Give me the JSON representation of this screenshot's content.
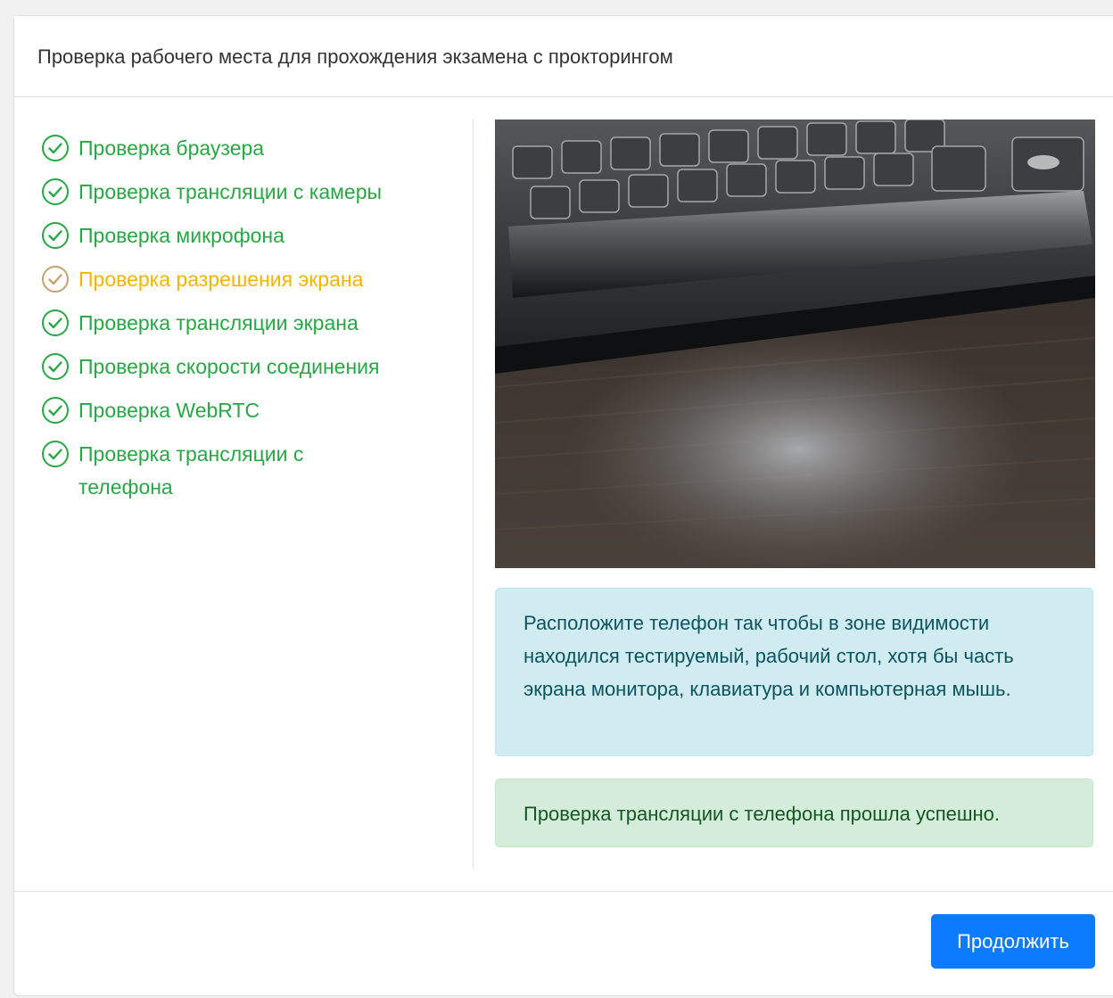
{
  "header": {
    "title": "Проверка рабочего места для прохождения экзамена с прокторингом"
  },
  "colors": {
    "ok": "#28a745",
    "warn": "#f5b400",
    "primary": "#0d7bff"
  },
  "steps": [
    {
      "label": "Проверка браузера",
      "status": "ok",
      "icon": "check-circle-icon"
    },
    {
      "label": "Проверка трансляции с камеры",
      "status": "ok",
      "icon": "check-circle-icon"
    },
    {
      "label": "Проверка микрофона",
      "status": "ok",
      "icon": "check-circle-icon"
    },
    {
      "label": "Проверка разрешения экрана",
      "status": "warn",
      "icon": "check-circle-icon"
    },
    {
      "label": "Проверка трансляции экрана",
      "status": "ok",
      "icon": "check-circle-icon"
    },
    {
      "label": "Проверка скорости соединения",
      "status": "ok",
      "icon": "check-circle-icon"
    },
    {
      "label": "Проверка WebRTC",
      "status": "ok",
      "icon": "check-circle-icon"
    },
    {
      "label": "Проверка трансляции с телефона",
      "status": "ok",
      "icon": "check-circle-icon"
    }
  ],
  "info_alert": {
    "text": "Расположите телефон так чтобы в зоне видимости находился тестируемый, рабочий стол, хотя бы часть экрана монитора, клавиатура и компьютерная мышь."
  },
  "success_alert": {
    "text": "Проверка трансляции с телефона прошла успешно."
  },
  "footer": {
    "continue_label": "Продолжить"
  }
}
